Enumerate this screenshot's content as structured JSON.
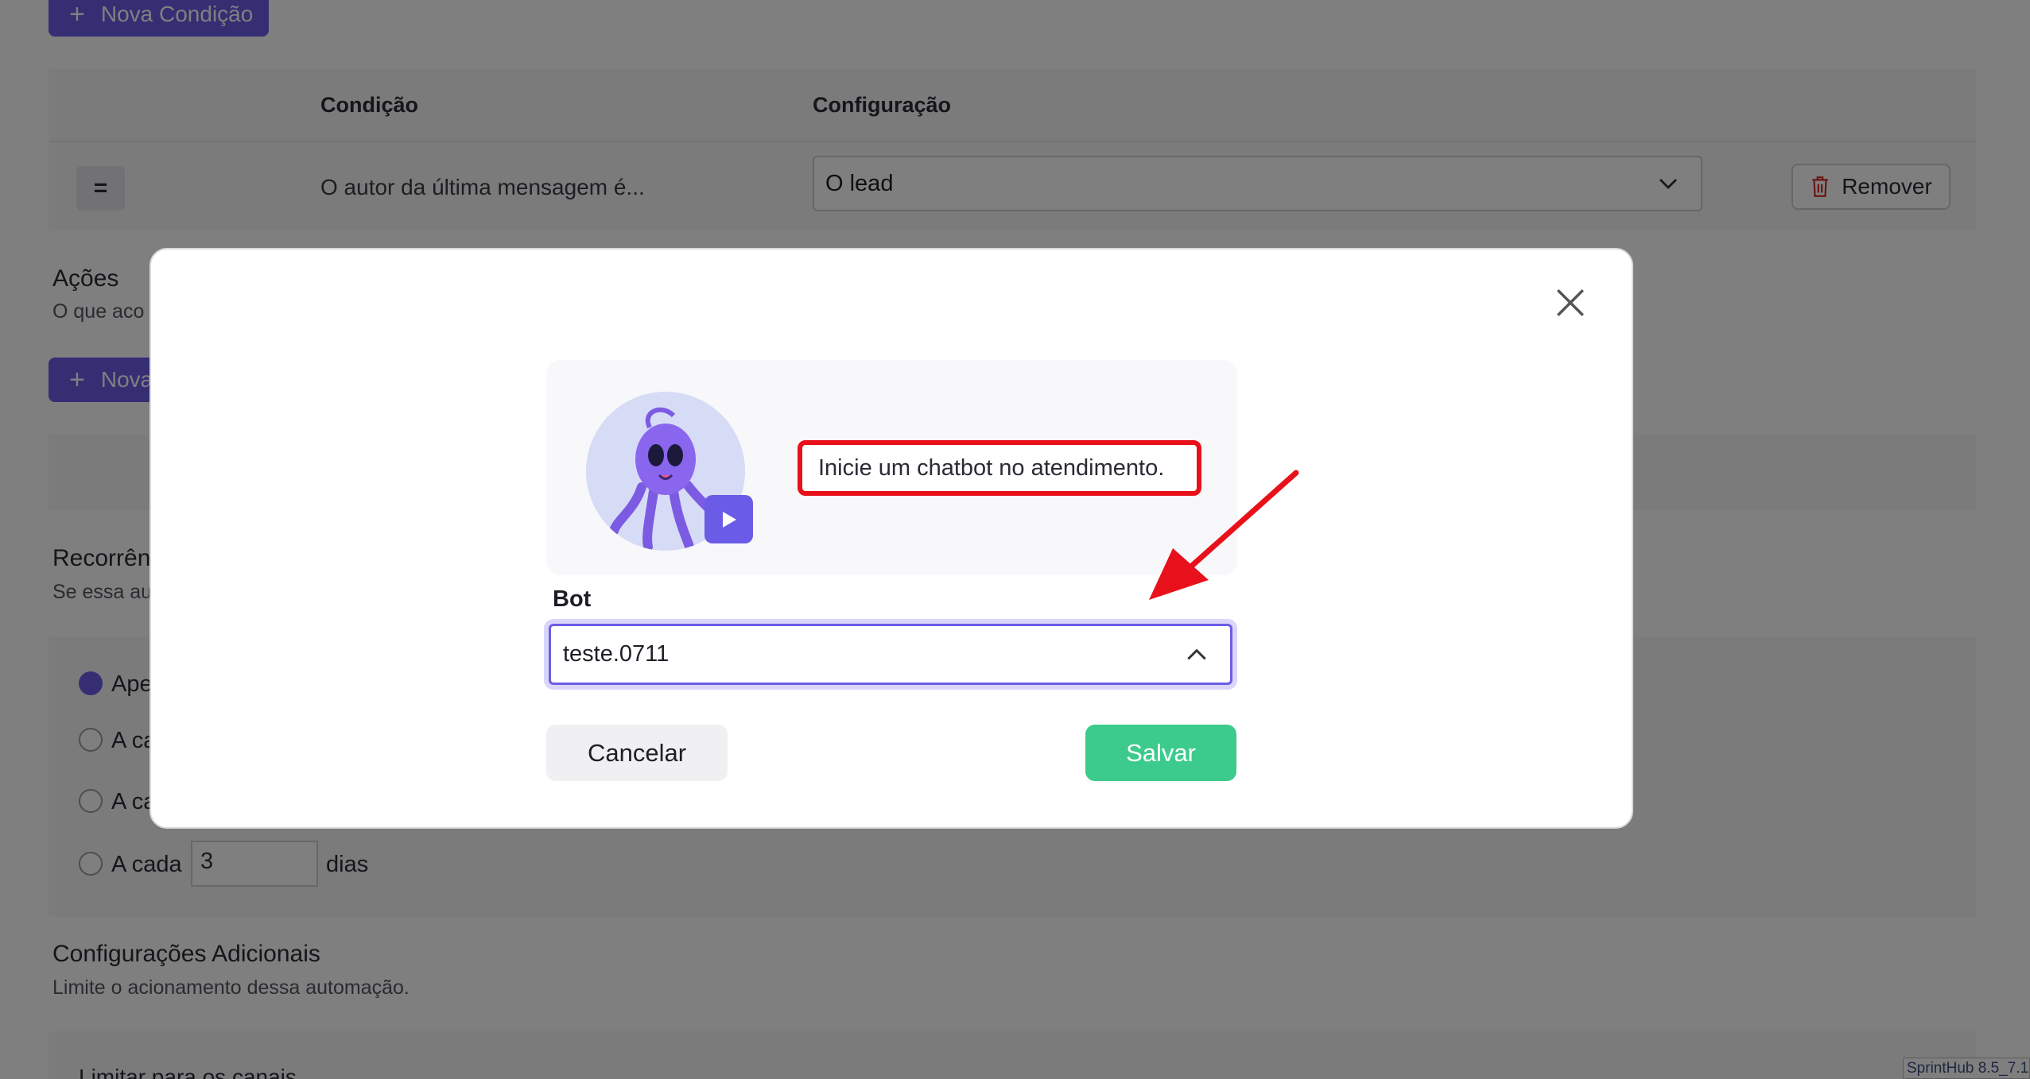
{
  "background": {
    "new_condition_button": "Nova Condição",
    "condition_table": {
      "col_condition": "Condição",
      "col_config": "Configuração",
      "row": {
        "operator": "=",
        "condition_text": "O autor da última mensagem é...",
        "config_value": "O lead",
        "remove_label": "Remover"
      }
    },
    "actions": {
      "title": "Ações",
      "subtitle": "O que aco",
      "new_action_button": "Nova"
    },
    "recurrence": {
      "title": "Recorrên",
      "subtitle": "Se essa au",
      "options": [
        {
          "label": "Ape",
          "checked": true
        },
        {
          "label": "A ca",
          "checked": false
        },
        {
          "label": "A ca",
          "checked": false
        },
        {
          "label": "A cada",
          "checked": false
        }
      ],
      "days_value": "3",
      "days_unit": "dias"
    },
    "additional": {
      "title": "Configurações Adicionais",
      "subtitle": "Limite o acionamento dessa automação.",
      "limit_channels": "Limitar para os canais"
    },
    "version": "SprintHub 8.5_7.1"
  },
  "modal": {
    "intro_text": "Inicie um chatbot no atendimento.",
    "bot_label": "Bot",
    "bot_value": "teste.0711",
    "cancel_label": "Cancelar",
    "save_label": "Salvar"
  },
  "colors": {
    "accent": "#6b5ce7",
    "save": "#3ccb8c",
    "highlight": "#e8111b"
  }
}
